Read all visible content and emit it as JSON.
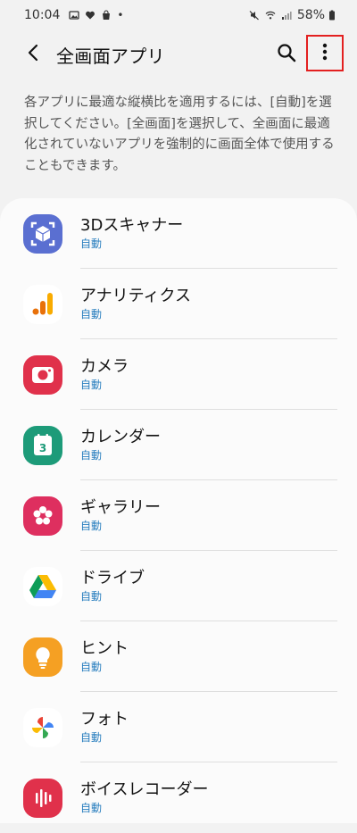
{
  "status_bar": {
    "time": "10:04",
    "dot": "•",
    "battery": "58%"
  },
  "header": {
    "title": "全画面アプリ"
  },
  "description": "各アプリに最適な縦横比を適用するには、[自動]を選択してください。[全画面]を選択して、全画面に最適化されていないアプリを強制的に画面全体で使用することもできます。",
  "apps": [
    {
      "name": "3Dスキャナー",
      "status": "自動",
      "icon": "3d-scanner-icon"
    },
    {
      "name": "アナリティクス",
      "status": "自動",
      "icon": "analytics-icon"
    },
    {
      "name": "カメラ",
      "status": "自動",
      "icon": "camera-icon"
    },
    {
      "name": "カレンダー",
      "status": "自動",
      "icon": "calendar-icon",
      "icon_text": "3"
    },
    {
      "name": "ギャラリー",
      "status": "自動",
      "icon": "gallery-icon"
    },
    {
      "name": "ドライブ",
      "status": "自動",
      "icon": "drive-icon"
    },
    {
      "name": "ヒント",
      "status": "自動",
      "icon": "tips-icon"
    },
    {
      "name": "フォト",
      "status": "自動",
      "icon": "photos-icon"
    },
    {
      "name": "ボイスレコーダー",
      "status": "自動",
      "icon": "voice-recorder-icon"
    }
  ],
  "colors": {
    "status_link": "#2a7fbf",
    "highlight": "#e32020"
  }
}
